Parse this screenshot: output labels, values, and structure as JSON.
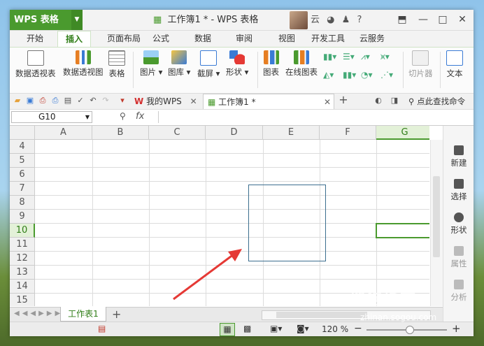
{
  "app": {
    "name": "WPS 表格",
    "doc_title": "工作簿1 * - WPS 表格"
  },
  "titlebar": {
    "user_initial": "云",
    "help": "?"
  },
  "ribbon_tabs": [
    "开始",
    "插入",
    "页面布局",
    "公式",
    "数据",
    "审阅",
    "视图",
    "开发工具",
    "云服务"
  ],
  "ribbon": {
    "pivot_table": "数据透视表",
    "pivot_chart": "数据透视图",
    "table": "表格",
    "picture": "图片",
    "gallery": "图库",
    "screenshot": "截屏",
    "shape": "形状",
    "chart": "图表",
    "online_chart": "在线图表",
    "clip_art": "切片器",
    "text": "文本"
  },
  "docbar": {
    "my_wps": "我的WPS",
    "workbook_tab": "工作簿1 *",
    "search": "点此查找命令"
  },
  "formula_bar": {
    "name_box": "G10",
    "fx": "fx"
  },
  "grid": {
    "columns": [
      "A",
      "B",
      "C",
      "D",
      "E",
      "F",
      "G"
    ],
    "rows": [
      "4",
      "5",
      "6",
      "7",
      "8",
      "9",
      "10",
      "11",
      "12",
      "13",
      "14",
      "15"
    ],
    "selected_col": "G",
    "selected_row": "10"
  },
  "right_panel": {
    "new": "新建",
    "select": "选择",
    "shape": "形状",
    "property": "属性",
    "analysis": "分析"
  },
  "sheet_tabs": {
    "sheet1": "工作表1",
    "add": "+"
  },
  "status": {
    "zoom": "120 %",
    "minus": "−",
    "plus": "+"
  },
  "watermark": {
    "brand": "搜狗指南",
    "url": "zhinan.sogou.com"
  },
  "colors": {
    "accent": "#4a9a2e",
    "shape_border": "#3c6e8f",
    "arrow": "#e53935"
  }
}
